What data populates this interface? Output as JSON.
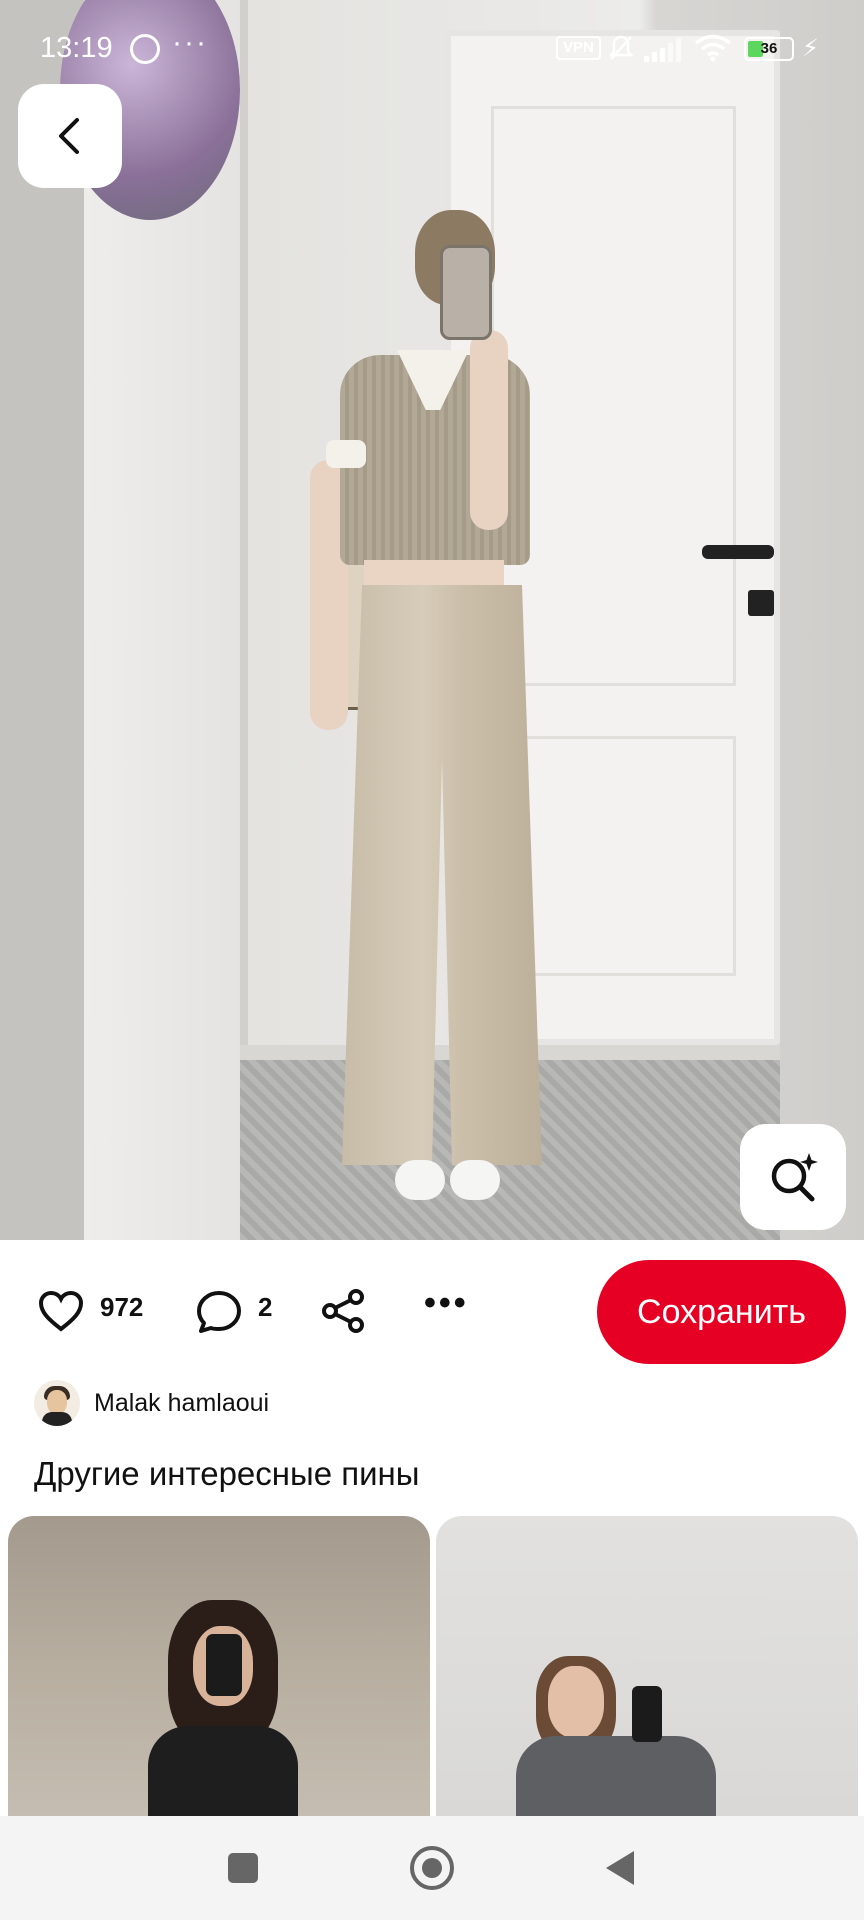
{
  "status_bar": {
    "time": "13:19",
    "notification_icons": [
      "whatsapp-icon",
      "more-dots-icon"
    ],
    "vpn_label": "VPN",
    "battery_percent": "36",
    "battery_level": 0.36,
    "system_icons": [
      "vpn-icon",
      "mute-bell-icon",
      "signal-icon",
      "wifi-icon",
      "battery-icon",
      "charging-bolt-icon"
    ]
  },
  "pin": {
    "back_icon": "chevron-left-icon",
    "visual_search_icon": "sparkle-search-icon"
  },
  "actions": {
    "likes_count": "972",
    "comments_count": "2",
    "save_label": "Сохранить",
    "save_color": "#e60023"
  },
  "author": {
    "name": "Malak hamlaoui"
  },
  "related": {
    "title": "Другие интересные пины"
  },
  "nav_bar": {
    "icons": [
      "recent-apps-icon",
      "home-icon",
      "back-icon"
    ]
  }
}
